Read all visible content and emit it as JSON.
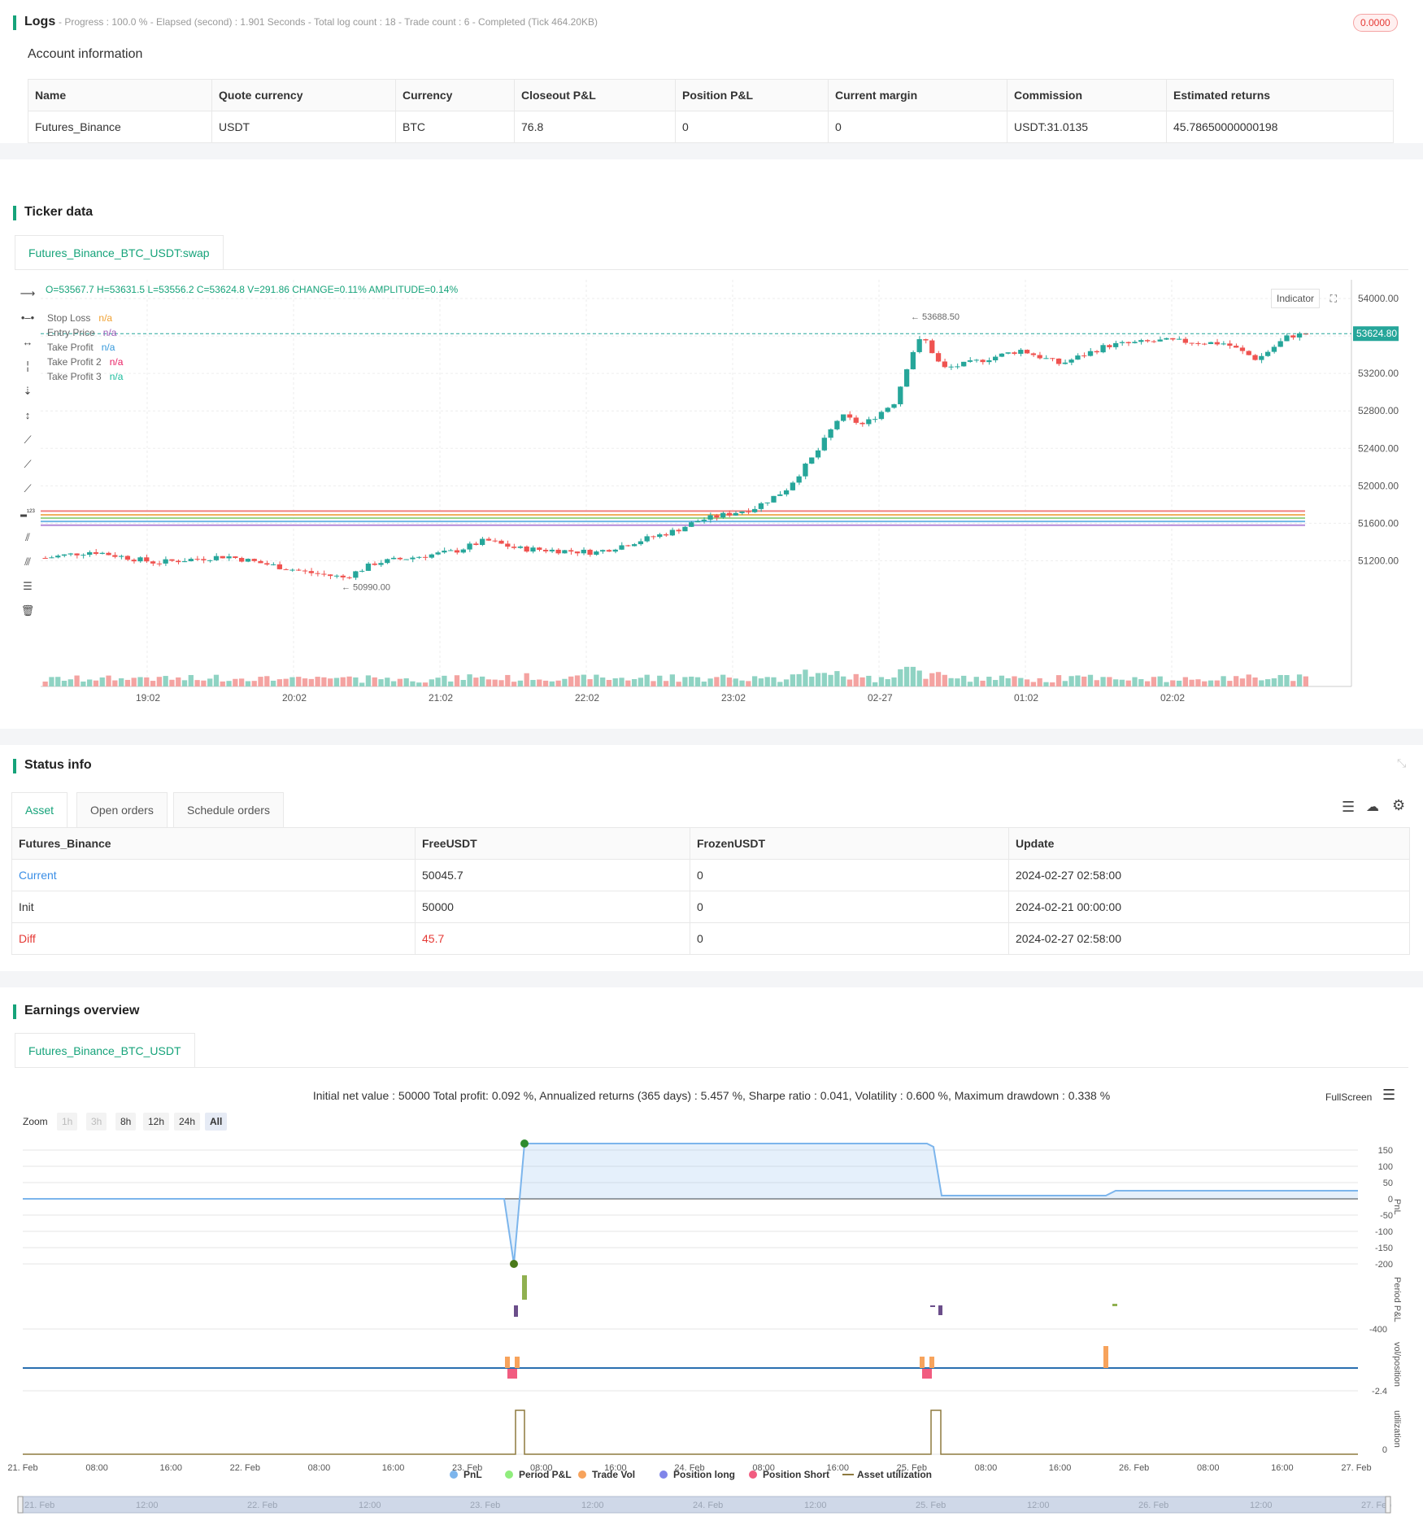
{
  "logs": {
    "title": "Logs",
    "status": "- Progress : 100.0 % - Elapsed (second) : 1.901 Seconds - Total log count : 18 - Trade count : 6 - Completed (Tick 464.20KB)",
    "badge": "0.0000"
  },
  "account": {
    "title": "Account information",
    "headers": [
      "Name",
      "Quote currency",
      "Currency",
      "Closeout P&L",
      "Position P&L",
      "Current margin",
      "Commission",
      "Estimated returns"
    ],
    "row": [
      "Futures_Binance",
      "USDT",
      "BTC",
      "76.8",
      "0",
      "0",
      "USDT:31.0135",
      "45.78650000000198"
    ]
  },
  "ticker": {
    "title": "Ticker data",
    "tab": "Futures_Binance_BTC_USDT:swap",
    "ohlc": "O=53567.7 H=53631.5 L=53556.2 C=53624.8 V=291.86 CHANGE=0.11% AMPLITUDE=0.14%",
    "indicator_btn": "Indicator",
    "legend": [
      {
        "label": "Stop Loss",
        "value": "n/a",
        "color": "#f0a030"
      },
      {
        "label": "Entry Price",
        "value": "n/a",
        "color": "#9b59b6"
      },
      {
        "label": "Take Profit",
        "value": "n/a",
        "color": "#3498db"
      },
      {
        "label": "Take Profit 2",
        "value": "n/a",
        "color": "#e91e63"
      },
      {
        "label": "Take Profit 3",
        "value": "n/a",
        "color": "#1abc9c"
      }
    ],
    "price_ticks": [
      "54000.00",
      "53600.00",
      "53200.00",
      "52800.00",
      "52400.00",
      "52000.00",
      "51600.00",
      "51200.00"
    ],
    "time_ticks": [
      "19:02",
      "20:02",
      "21:02",
      "22:02",
      "23:02",
      "02-27",
      "01:02",
      "02:02"
    ],
    "last_price": "53624.80",
    "high_label": "53688.50",
    "low_label": "50990.00"
  },
  "status": {
    "title": "Status info",
    "tabs": [
      "Asset",
      "Open orders",
      "Schedule orders"
    ],
    "headers": [
      "Futures_Binance",
      "FreeUSDT",
      "FrozenUSDT",
      "Update"
    ],
    "rows": [
      [
        "Current",
        "50045.7",
        "0",
        "2024-02-27 02:58:00"
      ],
      [
        "Init",
        "50000",
        "0",
        "2024-02-21 00:00:00"
      ],
      [
        "Diff",
        "45.7",
        "0",
        "2024-02-27 02:58:00"
      ]
    ]
  },
  "earnings": {
    "title": "Earnings overview",
    "tab": "Futures_Binance_BTC_USDT",
    "summary": "Initial net value : 50000 Total profit: 0.092 %, Annualized returns (365 days) : 5.457 %, Sharpe ratio : 0.041, Volatility : 0.600 %, Maximum drawdown : 0.338 %",
    "fullscreen": "FullScreen",
    "zoom_label": "Zoom",
    "zoom_options": [
      "1h",
      "3h",
      "8h",
      "12h",
      "24h",
      "All"
    ],
    "pnl_ticks": [
      "150",
      "100",
      "50",
      "0",
      "-50",
      "-100",
      "-150",
      "-200"
    ],
    "axis_titles": [
      "PnL",
      "Period P&L",
      "vol/position",
      "utilization"
    ],
    "period_tick": "-400",
    "vol_tick": "-2.4",
    "util_tick": "0",
    "x_ticks": [
      "21. Feb",
      "08:00",
      "16:00",
      "22. Feb",
      "08:00",
      "16:00",
      "23. Feb",
      "08:00",
      "16:00",
      "24. Feb",
      "08:00",
      "16:00",
      "25. Feb",
      "08:00",
      "16:00",
      "26. Feb",
      "08:00",
      "16:00",
      "27. Feb"
    ],
    "legend": [
      {
        "label": "PnL",
        "color": "#7cb5ec"
      },
      {
        "label": "Period P&L",
        "color": "#90ed7d"
      },
      {
        "label": "Trade Vol",
        "color": "#f7a35c"
      },
      {
        "label": "Position long",
        "color": "#8085e9"
      },
      {
        "label": "Position Short",
        "color": "#f15c80"
      },
      {
        "label": "Asset utilization",
        "color": "#8d7a3f"
      }
    ],
    "navigator_ticks": [
      "21. Feb",
      "12:00",
      "22. Feb",
      "12:00",
      "23. Feb",
      "12:00",
      "24. Feb",
      "12:00",
      "25. Feb",
      "12:00",
      "26. Feb",
      "12:00",
      "27. Feb"
    ]
  },
  "colors": {
    "accent": "#16a37a",
    "up": "#26a69a",
    "down": "#ef5350"
  }
}
